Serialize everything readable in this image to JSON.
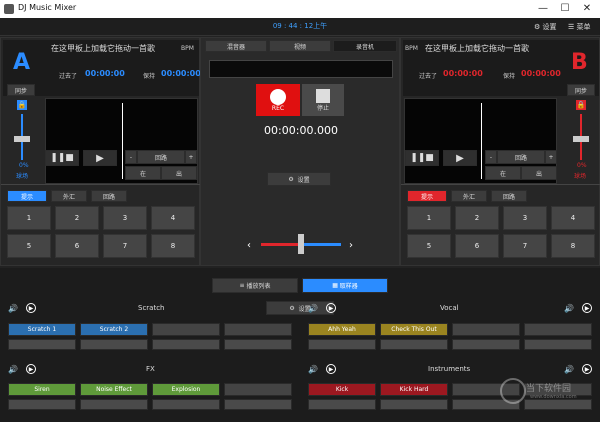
{
  "window": {
    "title": "DJ Music Mixer",
    "min": "—",
    "max": "☐",
    "close": "✕"
  },
  "topbar": {
    "clock": "09 : 44 : 12上午",
    "settings_label": "设置",
    "menu_label": "菜单"
  },
  "deck_a": {
    "letter": "A",
    "letter_color": "#2b8cff",
    "song": "在这甲板上加载它拖动一首歌",
    "bpm_label": "BPM",
    "elapsed_label": "过去了",
    "elapsed_time": "00:00:00",
    "remain_label": "保持",
    "remain_time": "00:00:00",
    "time_color": "#2b8cff",
    "sync_label": "同步",
    "pitch_value": "0%",
    "pitch_sub": "球场",
    "loop_label": "回路",
    "in_label": "在",
    "out_label": "出",
    "tabs": [
      "提示",
      "外汇",
      "回路"
    ],
    "pads": [
      "1",
      "2",
      "3",
      "4",
      "5",
      "6",
      "7",
      "8"
    ]
  },
  "deck_b": {
    "letter": "B",
    "letter_color": "#e0262c",
    "song": "在这甲板上加载它拖动一首歌",
    "bpm_label": "BPM",
    "elapsed_label": "过去了",
    "elapsed_time": "00:00:00",
    "remain_label": "保持",
    "remain_time": "00:00:00",
    "time_color": "#e0262c",
    "sync_label": "同步",
    "pitch_value": "0%",
    "pitch_sub": "球场",
    "loop_label": "回路",
    "in_label": "在",
    "out_label": "出",
    "tabs": [
      "提示",
      "外汇",
      "回路"
    ],
    "pads": [
      "1",
      "2",
      "3",
      "4",
      "5",
      "6",
      "7",
      "8"
    ]
  },
  "center": {
    "tabs": [
      "混音器",
      "视频",
      "录音机"
    ],
    "rec_label": "REC",
    "stop_label": "停止",
    "rec_time": "00:00:00.000",
    "settings_label": "设置"
  },
  "sampler": {
    "playlist_label": "播放列表",
    "sampler_label": "取样器",
    "settings_label": "设置",
    "groups": [
      {
        "name": "Scratch",
        "slots": [
          "Scratch 1",
          "Scratch 2",
          "",
          ""
        ],
        "color": "blue"
      },
      {
        "name": "Vocal",
        "slots": [
          "Ahh Yeah",
          "Check This Out",
          "",
          ""
        ],
        "color": "gold"
      },
      {
        "name": "FX",
        "slots": [
          "Siren",
          "Noise Effect",
          "Explosion",
          ""
        ],
        "color": "green"
      },
      {
        "name": "Instruments",
        "slots": [
          "Kick",
          "Kick Hard",
          "",
          ""
        ],
        "color": "red"
      }
    ]
  },
  "watermark": {
    "text": "当下软件园",
    "url": "www.downxia.com"
  }
}
